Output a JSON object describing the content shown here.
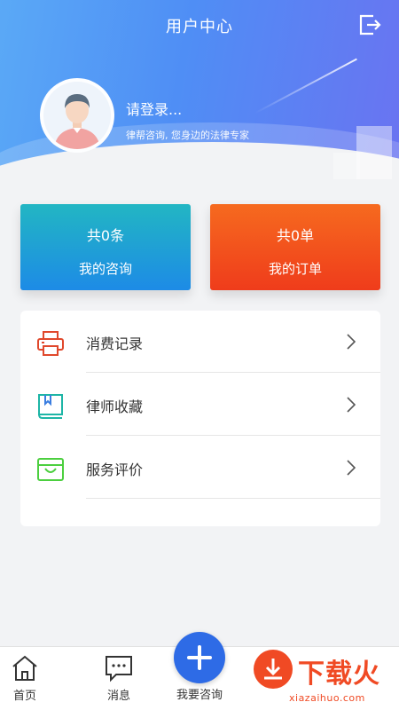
{
  "header": {
    "title": "用户中心",
    "login_prompt": "请登录...",
    "slogan": "律帮咨询, 您身边的法律专家"
  },
  "cards": {
    "consult": {
      "count": "共0条",
      "label": "我的咨询"
    },
    "order": {
      "count": "共0单",
      "label": "我的订单"
    }
  },
  "menu": {
    "items": [
      {
        "label": "消费记录",
        "icon": "printer-icon"
      },
      {
        "label": "律师收藏",
        "icon": "bookmark-book-icon"
      },
      {
        "label": "服务评价",
        "icon": "shopping-bag-icon"
      }
    ]
  },
  "bottom_nav": {
    "home": "首页",
    "messages": "消息",
    "consult": "我要咨询"
  },
  "watermark": {
    "text": "下载火",
    "url": "xiazaihuo.com"
  },
  "colors": {
    "header_start": "#5aa9f6",
    "header_end": "#6a73f1",
    "consult_card": "#1d8be6",
    "order_card": "#ef3c1b",
    "accent_blue": "#2e6be6"
  }
}
